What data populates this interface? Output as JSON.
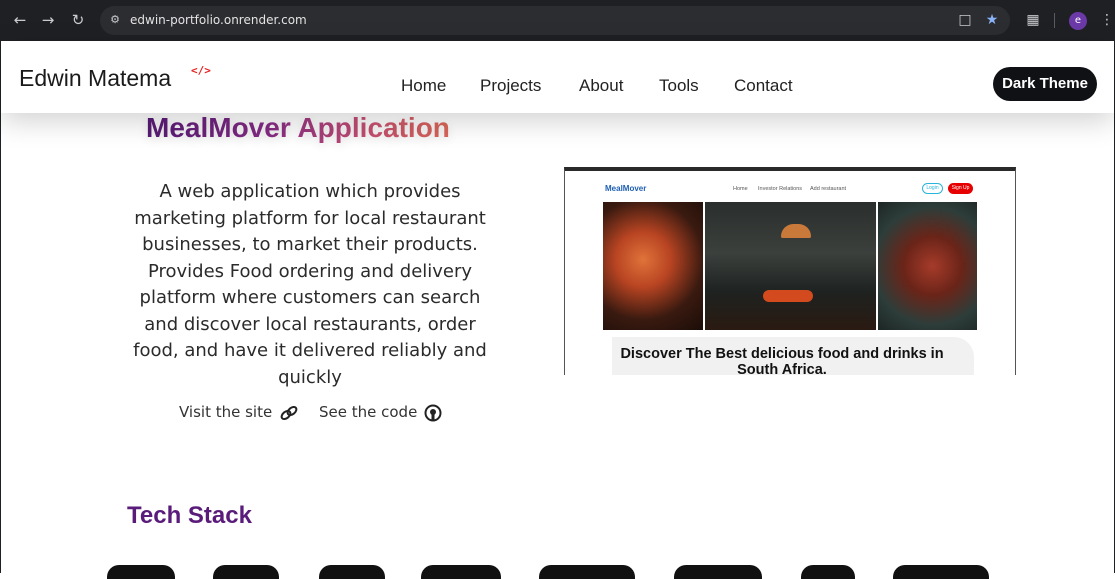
{
  "browser": {
    "url": "edwin-portfolio.onrender.com",
    "profile_initial": "e",
    "icons": [
      "back-icon",
      "forward-icon",
      "reload-icon",
      "site-info-icon",
      "cast-icon",
      "star-icon",
      "extensions-icon",
      "menu-icon"
    ]
  },
  "header": {
    "logo_text": "Edwin Matema",
    "logo_mark": "</>",
    "nav": [
      "Home",
      "Projects",
      "About",
      "Tools",
      "Contact"
    ],
    "theme_button": "Dark Theme"
  },
  "project": {
    "title": "MealMover Application",
    "description": "A web application which provides marketing platform for local restaurant businesses, to market their products. Provides Food ordering and delivery platform where customers can search and discover local restaurants, order food, and have it delivered reliably and quickly",
    "visit_label": "Visit the site",
    "code_label": "See the code"
  },
  "preview": {
    "logo": "MealMover",
    "nav": [
      "Home",
      "Investor Relations",
      "Add restaurant"
    ],
    "login": "Login",
    "signup": "Sign Up",
    "banner": "Discover The Best delicious food and drinks in South Africa."
  },
  "tech": {
    "title": "Tech Stack"
  },
  "colors": {
    "brand_purple": "#5a1c7a",
    "accent_red": "#e62020",
    "button_dark": "#0f1115"
  }
}
